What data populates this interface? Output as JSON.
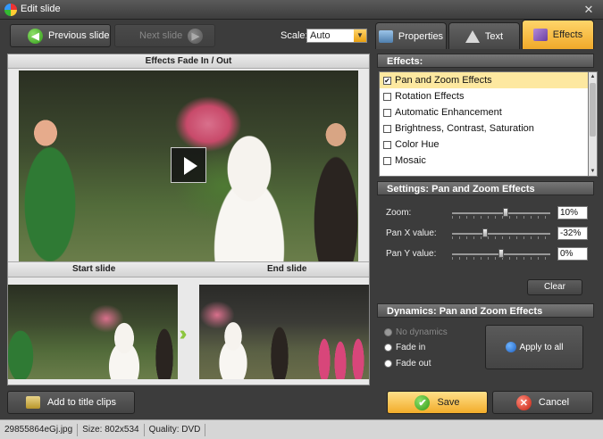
{
  "window": {
    "title": "Edit slide"
  },
  "toolbar": {
    "previous_label": "Previous slide",
    "next_label": "Next slide",
    "scale_label": "Scale:",
    "scale_value": "Auto"
  },
  "preview": {
    "header": "Effects Fade In / Out",
    "start_label": "Start slide",
    "end_label": "End slide"
  },
  "tabs": [
    {
      "label": "Properties",
      "active": false
    },
    {
      "label": "Text",
      "active": false
    },
    {
      "label": "Effects",
      "active": true
    }
  ],
  "effects": {
    "header": "Effects:",
    "items": [
      {
        "label": "Pan and Zoom Effects",
        "checked": true,
        "selected": true
      },
      {
        "label": "Rotation Effects",
        "checked": false
      },
      {
        "label": "Automatic Enhancement",
        "checked": false
      },
      {
        "label": "Brightness, Contrast, Saturation",
        "checked": false
      },
      {
        "label": "Color Hue",
        "checked": false
      },
      {
        "label": "Mosaic",
        "checked": false
      }
    ]
  },
  "settings": {
    "header": "Settings: Pan and Zoom Effects",
    "rows": [
      {
        "label": "Zoom:",
        "value": "10%"
      },
      {
        "label": "Pan X value:",
        "value": "-32%"
      },
      {
        "label": "Pan Y value:",
        "value": "0%"
      }
    ],
    "clear_label": "Clear"
  },
  "dynamics": {
    "header": "Dynamics: Pan and Zoom Effects",
    "options": [
      {
        "label": "No dynamics",
        "enabled": false
      },
      {
        "label": "Fade in",
        "enabled": true
      },
      {
        "label": "Fade out",
        "enabled": true
      }
    ],
    "apply_label": "Apply to all"
  },
  "bottom": {
    "add_title_label": "Add to title clips",
    "save_label": "Save",
    "cancel_label": "Cancel"
  },
  "status": {
    "filename": "29855864eGj.jpg",
    "size": "Size: 802x534",
    "quality": "Quality: DVD"
  }
}
